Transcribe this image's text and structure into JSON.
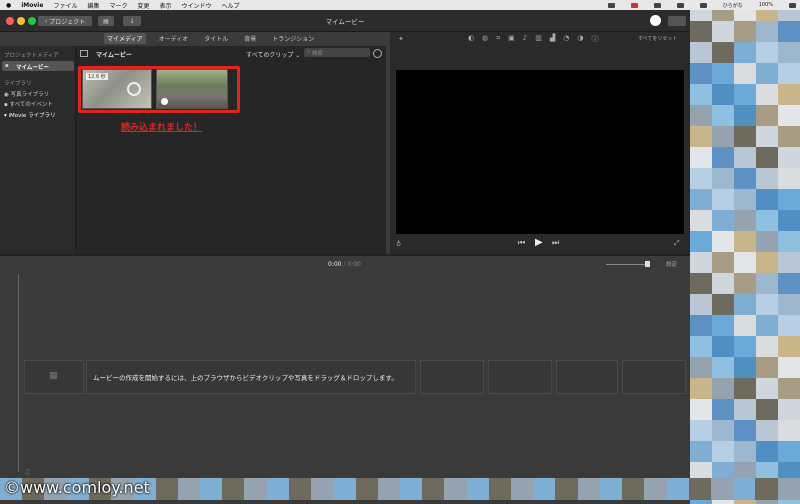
{
  "menubar": {
    "app": "iMovie",
    "items": [
      "ファイル",
      "編集",
      "マーク",
      "変更",
      "表示",
      "ウインドウ",
      "ヘルプ"
    ],
    "right_text": "ひらがな",
    "battery": "100%"
  },
  "toolbar": {
    "back_label": "プロジェクト",
    "window_title": "マイムービー"
  },
  "tabs": [
    "マイメディア",
    "オーディオ",
    "タイトル",
    "背景",
    "トランジション"
  ],
  "sidebar": {
    "section_project": "プロジェクトメディア",
    "project_item": "マイムービー",
    "section_library": "ライブラリ",
    "lib_items": [
      "写真ライブラリ",
      "すべてのイベント"
    ],
    "imovie_library": "iMovie ライブラリ"
  },
  "browser": {
    "title": "マイムービー",
    "filter": "すべてのクリップ",
    "search_placeholder": "検索",
    "clip1_badge": "12.6 秒",
    "annotation": "読み込まれました！"
  },
  "viewer": {
    "reset_label": "すべてをリセット"
  },
  "timeline": {
    "time_current": "0:00",
    "time_sep": "/",
    "time_total": "0:00",
    "settings_label": "設定",
    "empty_message": "ムービーの作成を開始するには、上のブラウザからビデオクリップや写真をドラッグ＆ドロップします。"
  },
  "watermark": "©www.comloy.net",
  "colors": {
    "accent_red": "#e0261b",
    "active_tab": "#545454"
  }
}
